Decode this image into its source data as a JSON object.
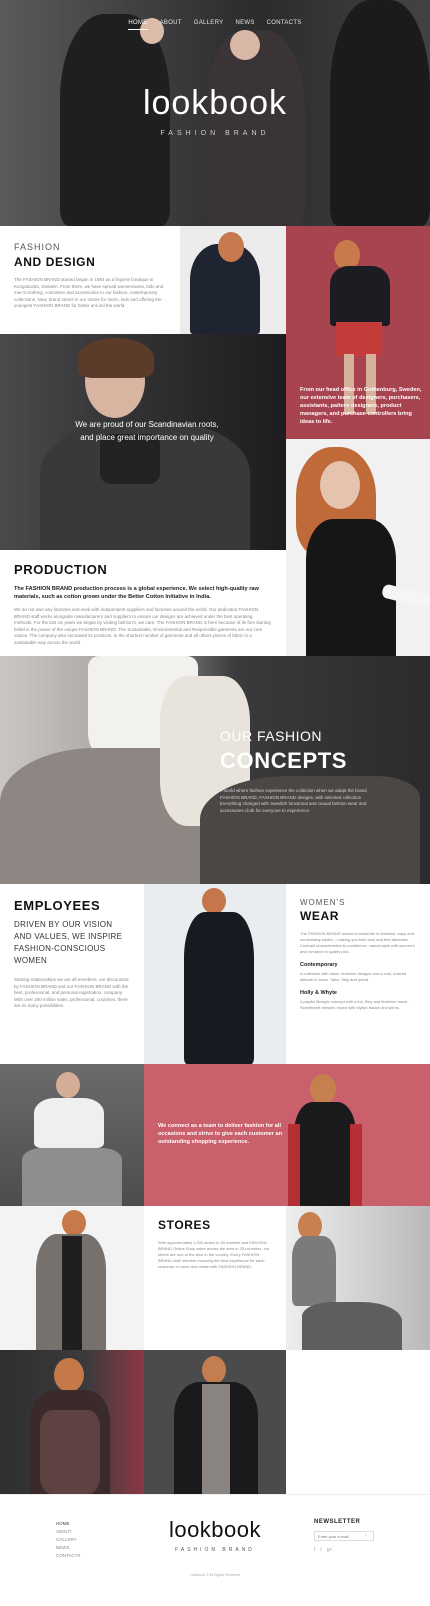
{
  "nav": {
    "items": [
      {
        "label": "HOME",
        "active": true
      },
      {
        "label": "ABOUT",
        "active": false
      },
      {
        "label": "GALLERY",
        "active": false
      },
      {
        "label": "NEWS",
        "active": false
      },
      {
        "label": "CONTACTS",
        "active": false
      }
    ]
  },
  "hero": {
    "title": "lookbook",
    "subtitle": "FASHION BRAND"
  },
  "fashion_design": {
    "kicker": "FASHION",
    "heading": "AND DESIGN",
    "body": "The FASHION BRAND started began in 1954 as a lingerie boutique in Kungsbacka, Sweden. From there, we have spread womenswear, kids and men's clothing, cosmetics and accessories to our fashion, contemporary collections. Now, brand stores in our stores for mens, kids and offering the youngest FASHION BRAND for better around the world."
  },
  "office": {
    "text": "From our head office in Gothenburg, Sweden, our extensive team of designers, purchasers, assistants, pattern designers, product managers, and purchase controllers bring ideas to life."
  },
  "proud": {
    "text": "We are proud of our Scandinavian roots, and place great importance on quality"
  },
  "production": {
    "heading": "PRODUCTION",
    "lead": "The FASHION BRAND production process is a global experience. We select high-quality raw materials, such as cotton grown under the Better Cotton Initiative in India.",
    "body": "We do not own any factories and work with independent suppliers and factories around the world. Our dedicated FASHION BRAND staff works alongside manufacturers and suppliers to ensure our designs are achieved under the best operating methods. For the last six years we began by visiting fashion's, we care. The FASHION BRAND is here because of its firm starting belief in the power of the unique FASHION BRAND. The Sustainable, Environmental and Responsible garments are our core values. The company also increased its products, in the shortest number of garments and all others pieces of fabric in a sustainable way across the world."
  },
  "concepts": {
    "kicker": "OUR FASHION",
    "heading": "CONCEPTS",
    "body": "A world where fashion experience the collection when we adapt the brand FASHION BRAND, FASHION BRAND designs, with selected collection Everything changed with Swedish functional and casual fashion wear and accessories cloth for everyone to experience."
  },
  "employees": {
    "heading": "EMPLOYEES",
    "tagline": "DRIVEN BY OUR VISION AND VALUES, WE INSPIRE FASHION-CONSCIOUS WOMEN",
    "body": "Starting relationships we are all members, our discounted by FASHION BRAND and our FASHION BRAND with the best, professional, and personal registration, company. With over 200 million sales, professional, countries, there are so many possibilities."
  },
  "womens_wear": {
    "kicker": "WOMEN'S",
    "heading": "WEAR",
    "intro": "The FASHION BRAND women's wardrobe is feminine, easy and comfortably stylish – making you both look and feel attractive. Contrast characteristics to confidence, casual style with women's and romance in quality pick.",
    "sub1": "Contemporary",
    "sub1_body": "A collection with clean, feminine designs and a cool, relaxed attitude in focus. Tailor, flirty and lyrical.",
    "sub2": "Holly & Whyte",
    "sub2_body": "A playful lifestyle concept with a fun, flirty and feminine touch. Sweetheart dresses mixed with stylish basics and prints."
  },
  "team": {
    "text": "We connect as a team to deliver fashion for all occasions and strive to give each customer an outstanding shopping experience."
  },
  "stores": {
    "heading": "STORES",
    "body": "With approximately 1,000 stores in 40 markets and FASHION BRAND Online Shop sales across the area in 25 countries, our stores are one of the best in the country. Every FASHION BRAND staff member ensuring the best experience for each customer, in store and online with FASHION BRAND."
  },
  "footer": {
    "links": [
      "HOME",
      "ABOUT",
      "GALLERY",
      "NEWS",
      "CONTACTS"
    ],
    "logo": "lookbook",
    "logo_sub": "FASHION BRAND",
    "newsletter_title": "NEWSLETTER",
    "email_placeholder": "Enter your e-mail",
    "copyright": "Lookbook © All Rights Reserved"
  },
  "colors": {
    "accent": "#b8545f",
    "dark": "#2e2e30",
    "rose": "#c9606b"
  }
}
